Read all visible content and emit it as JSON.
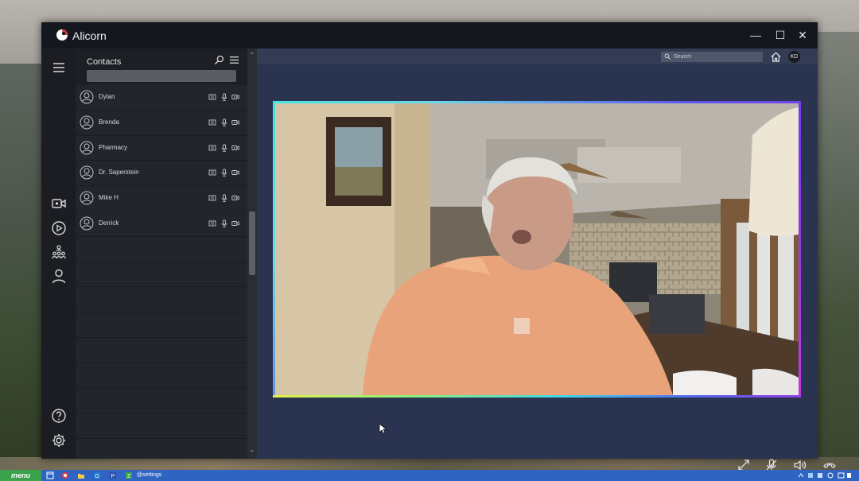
{
  "window": {
    "title": "Alicorn",
    "controls": {
      "minimize": "—",
      "maximize": "☐",
      "close": "✕"
    }
  },
  "rail": {
    "icons": [
      "menu-icon",
      "video-camera-icon",
      "play-icon",
      "group-icon",
      "user-icon",
      "help-icon",
      "gear-icon"
    ]
  },
  "contacts": {
    "title": "Contacts",
    "search_value": "",
    "items": [
      {
        "name": "Dylan"
      },
      {
        "name": "Brenda"
      },
      {
        "name": "Pharmacy"
      },
      {
        "name": "Dr. Saperstein"
      },
      {
        "name": "Mike H"
      },
      {
        "name": "Derrick"
      }
    ],
    "row_actions": [
      "message-icon",
      "microphone-icon",
      "video-icon"
    ]
  },
  "topbar": {
    "search_placeholder": "Search",
    "user_initials": "KD"
  },
  "call_controls": [
    "fullscreen-icon",
    "mute-mic-icon",
    "speaker-icon",
    "hang-up-icon"
  ],
  "taskbar": {
    "menu_label": "menu",
    "task_label": "@settings",
    "icons": [
      "window-icon",
      "record-icon",
      "folder-icon",
      "outlook-icon",
      "p-app-icon",
      "z-app-icon"
    ]
  },
  "colors": {
    "accent_frame_start": "#3ee6e3",
    "accent_frame_end": "#c33bdc",
    "taskbar": "#2f64c2",
    "menu_button": "#3aa24a"
  }
}
